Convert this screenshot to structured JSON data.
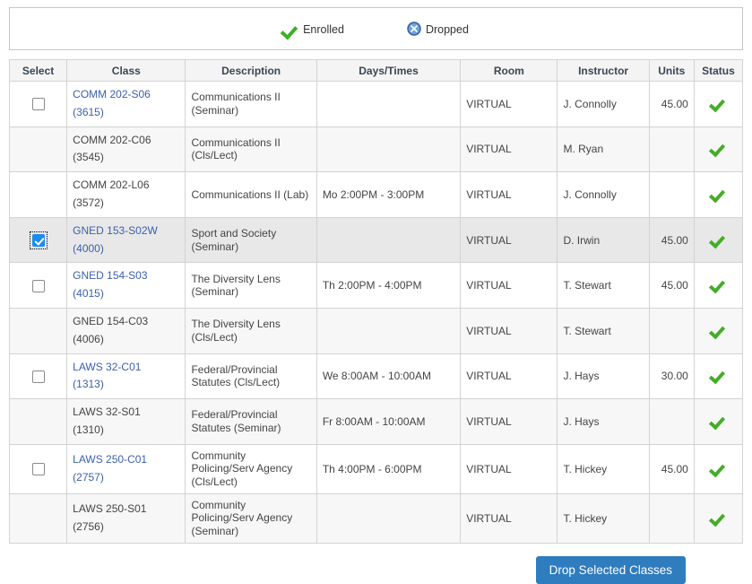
{
  "legend": {
    "enrolled": {
      "icon": "green-check-icon",
      "label": "Enrolled"
    },
    "dropped": {
      "icon": "blue-circle-x-icon",
      "label": "Dropped"
    }
  },
  "table": {
    "headers": {
      "select": "Select",
      "class": "Class",
      "description": "Description",
      "days_times": "Days/Times",
      "room": "Room",
      "instructor": "Instructor",
      "units": "Units",
      "status": "Status"
    },
    "rows": [
      {
        "selectable": true,
        "checked": false,
        "class_code": "COMM 202-S06",
        "class_num": "(3615)",
        "is_link": true,
        "description": "Communications II (Seminar)",
        "days_times": "",
        "room": "VIRTUAL",
        "instructor": "J. Connolly",
        "units": "45.00",
        "status_icon": "green-check-icon"
      },
      {
        "selectable": false,
        "checked": false,
        "class_code": "COMM 202-C06",
        "class_num": "(3545)",
        "is_link": false,
        "description": "Communications II (Cls/Lect)",
        "days_times": "",
        "room": "VIRTUAL",
        "instructor": "M. Ryan",
        "units": "",
        "status_icon": "green-check-icon"
      },
      {
        "selectable": false,
        "checked": false,
        "class_code": "COMM 202-L06",
        "class_num": "(3572)",
        "is_link": false,
        "description": "Communications II (Lab)",
        "days_times": "Mo 2:00PM - 3:00PM",
        "room": "VIRTUAL",
        "instructor": "J. Connolly",
        "units": "",
        "status_icon": "green-check-icon"
      },
      {
        "selectable": true,
        "checked": true,
        "class_code": "GNED 153-S02W",
        "class_num": "(4000)",
        "is_link": true,
        "description": "Sport and Society (Seminar)",
        "days_times": "",
        "room": "VIRTUAL",
        "instructor": "D. Irwin",
        "units": "45.00",
        "status_icon": "green-check-icon"
      },
      {
        "selectable": true,
        "checked": false,
        "class_code": "GNED 154-S03",
        "class_num": "(4015)",
        "is_link": true,
        "description": "The Diversity Lens (Seminar)",
        "days_times": "Th 2:00PM - 4:00PM",
        "room": "VIRTUAL",
        "instructor": "T. Stewart",
        "units": "45.00",
        "status_icon": "green-check-icon"
      },
      {
        "selectable": false,
        "checked": false,
        "class_code": "GNED 154-C03",
        "class_num": "(4006)",
        "is_link": false,
        "description": "The Diversity Lens (Cls/Lect)",
        "days_times": "",
        "room": "VIRTUAL",
        "instructor": "T. Stewart",
        "units": "",
        "status_icon": "green-check-icon"
      },
      {
        "selectable": true,
        "checked": false,
        "class_code": "LAWS 32-C01",
        "class_num": "(1313)",
        "is_link": true,
        "description": "Federal/Provincial Statutes (Cls/Lect)",
        "days_times": "We 8:00AM - 10:00AM",
        "room": "VIRTUAL",
        "instructor": "J. Hays",
        "units": "30.00",
        "status_icon": "green-check-icon"
      },
      {
        "selectable": false,
        "checked": false,
        "class_code": "LAWS 32-S01",
        "class_num": "(1310)",
        "is_link": false,
        "description": "Federal/Provincial Statutes (Seminar)",
        "days_times": "Fr 8:00AM - 10:00AM",
        "room": "VIRTUAL",
        "instructor": "J. Hays",
        "units": "",
        "status_icon": "green-check-icon"
      },
      {
        "selectable": true,
        "checked": false,
        "class_code": "LAWS 250-C01",
        "class_num": "(2757)",
        "is_link": true,
        "description": "Community Policing/Serv Agency (Cls/Lect)",
        "days_times": "Th 4:00PM - 6:00PM",
        "room": "VIRTUAL",
        "instructor": "T. Hickey",
        "units": "45.00",
        "status_icon": "green-check-icon"
      },
      {
        "selectable": false,
        "checked": false,
        "class_code": "LAWS 250-S01",
        "class_num": "(2756)",
        "is_link": false,
        "description": "Community Policing/Serv Agency (Seminar)",
        "days_times": "",
        "room": "VIRTUAL",
        "instructor": "T. Hickey",
        "units": "",
        "status_icon": "green-check-icon"
      }
    ]
  },
  "footer": {
    "drop_button_label": "Drop Selected Classes"
  },
  "colors": {
    "link": "#3a5fad",
    "enrolled_green": "#45ac28",
    "dropped_blue": "#4a86c8",
    "button_blue": "#2f7cbe",
    "selected_row": "#e8e8e8"
  }
}
